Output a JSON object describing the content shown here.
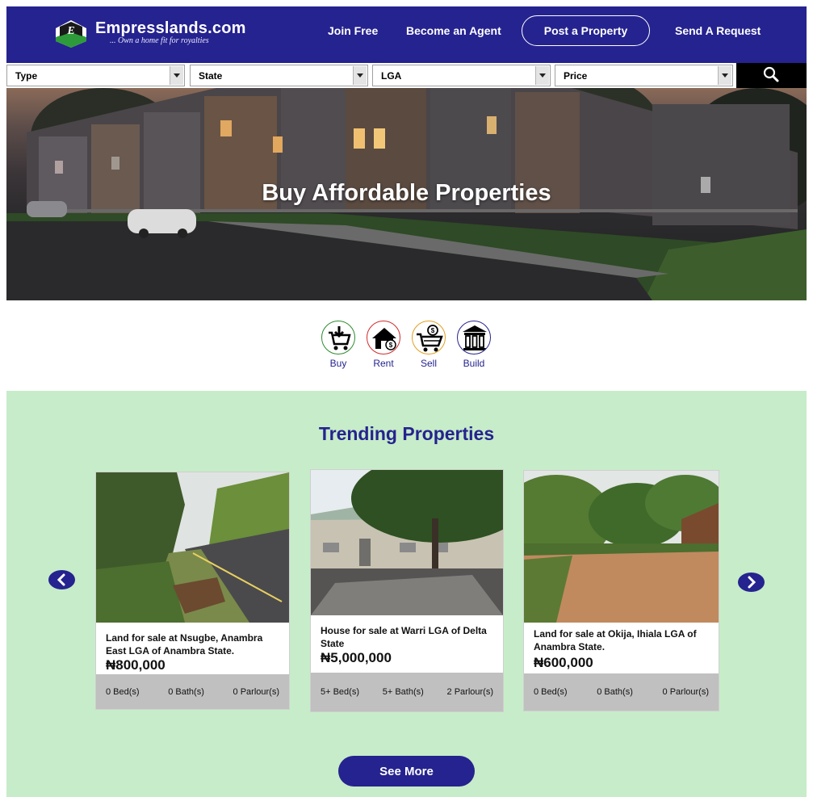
{
  "brand": {
    "name": "Empresslands.com",
    "tagline": "... Own a home fit for royalties",
    "logo_letter": "E"
  },
  "nav": {
    "join": "Join Free",
    "agent": "Become an Agent",
    "post": "Post a Property",
    "request": "Send A Request"
  },
  "filters": {
    "type": "Type",
    "state": "State",
    "lga": "LGA",
    "price": "Price"
  },
  "hero": {
    "title": "Buy Affordable Properties"
  },
  "categories": [
    {
      "label": "Buy",
      "icon": "cart-download-icon",
      "color": "#2e8b2e"
    },
    {
      "label": "Rent",
      "icon": "house-money-icon",
      "color": "#d22a2a"
    },
    {
      "label": "Sell",
      "icon": "cart-money-icon",
      "color": "#e0a020"
    },
    {
      "label": "Build",
      "icon": "bank-building-icon",
      "color": "#25238f"
    }
  ],
  "trending": {
    "title": "Trending Properties",
    "see_more": "See More",
    "cards": [
      {
        "title": "Land for sale at Nsugbe, Anambra East LGA of Anambra State.",
        "price": "₦800,000",
        "bed": "0 Bed(s)",
        "bath": "0 Bath(s)",
        "parlour": "0 Parlour(s)"
      },
      {
        "title": "House for sale at Warri LGA of Delta State",
        "price": "₦5,000,000",
        "bed": "5+ Bed(s)",
        "bath": "5+ Bath(s)",
        "parlour": "2 Parlour(s)"
      },
      {
        "title": "Land for sale at Okija, Ihiala LGA of Anambra State.",
        "price": "₦600,000",
        "bed": "0 Bed(s)",
        "bath": "0 Bath(s)",
        "parlour": "0 Parlour(s)"
      }
    ]
  },
  "colors": {
    "brand_blue": "#25238f",
    "trending_bg": "#c7ecc9",
    "feature_bar": "#c0c0c0"
  }
}
